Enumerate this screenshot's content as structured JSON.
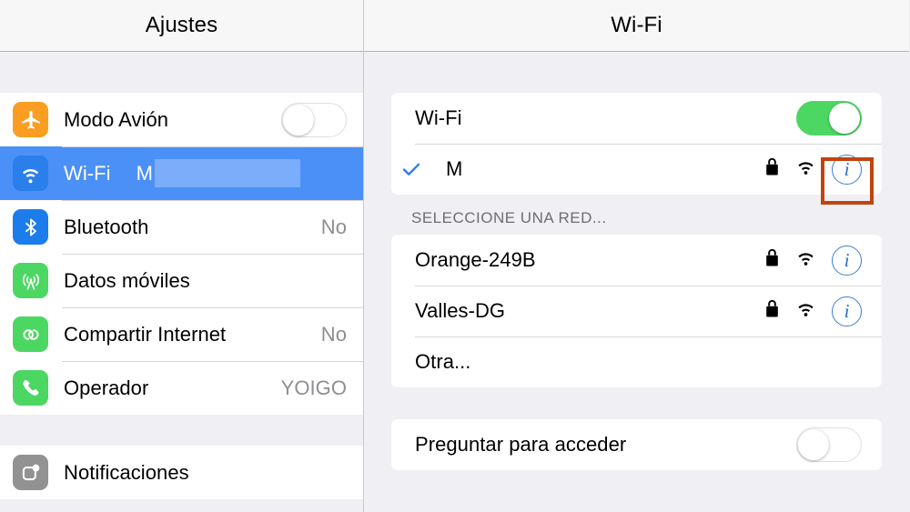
{
  "sidebar": {
    "title": "Ajustes",
    "groups": [
      {
        "items": [
          {
            "label": "Modo Avión",
            "icon": "airplane-icon",
            "control": "toggle",
            "toggle_state": "off",
            "value": ""
          },
          {
            "label": "Wi-Fi",
            "icon": "wifi-icon",
            "control": "value",
            "value": "M",
            "selected": true,
            "redacted": true
          },
          {
            "label": "Bluetooth",
            "icon": "bluetooth-icon",
            "control": "value",
            "value": "No"
          },
          {
            "label": "Datos móviles",
            "icon": "cellular-icon",
            "control": "value",
            "value": ""
          },
          {
            "label": "Compartir Internet",
            "icon": "tethering-icon",
            "control": "value",
            "value": "No"
          },
          {
            "label": "Operador",
            "icon": "phone-icon",
            "control": "value",
            "value": "YOIGO"
          }
        ]
      },
      {
        "items": [
          {
            "label": "Notificaciones",
            "icon": "notifications-icon",
            "control": "value",
            "value": ""
          }
        ]
      }
    ]
  },
  "detail": {
    "title": "Wi-Fi",
    "wifi_row": {
      "label": "Wi-Fi",
      "toggle_state": "on"
    },
    "connected_network": {
      "name": "M",
      "checked": true,
      "secured": true,
      "signal": "wifi-3-bars",
      "info_label": "i",
      "highlighted": true
    },
    "section_header": "SELECCIONE UNA RED...",
    "networks": [
      {
        "name": "Orange-249B",
        "secured": true,
        "signal": "wifi-3-bars",
        "info_label": "i",
        "has_icons": true
      },
      {
        "name": "Valles-DG",
        "secured": true,
        "signal": "wifi-3-bars",
        "info_label": "i",
        "has_icons": true
      },
      {
        "name": "Otra...",
        "secured": false,
        "has_icons": false
      }
    ],
    "ask_row": {
      "label": "Preguntar para acceder",
      "toggle_state": "off"
    }
  },
  "colors": {
    "selection_blue": "#4A90F7",
    "redaction_blue": "#7BAEFA",
    "toggle_on_green": "#4CD763",
    "highlight_orange": "#C1440E",
    "info_blue": "#2B6CC4",
    "icon_orange": "#FA9E23",
    "icon_blue": "#2B7FEA",
    "icon_green": "#4CD763",
    "icon_gray": "#929292",
    "secondary_text": "#8E8E93",
    "background": "#EFEFF4"
  }
}
